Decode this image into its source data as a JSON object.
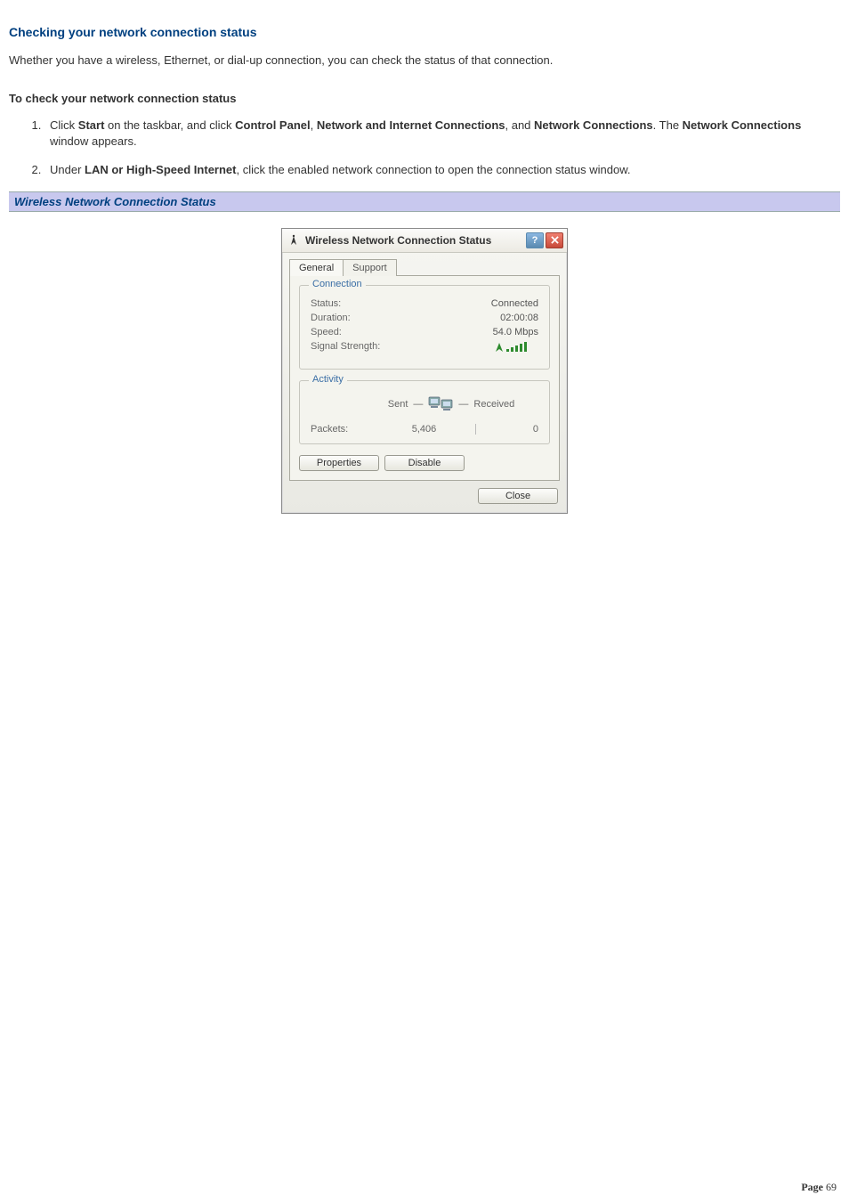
{
  "heading": "Checking your network connection status",
  "intro": "Whether you have a wireless, Ethernet, or dial-up connection, you can check the status of that connection.",
  "sub_heading": "To check your network connection status",
  "steps": [
    {
      "pre1": "Click ",
      "b1": "Start",
      "mid1": " on the taskbar, and click ",
      "b2": "Control Panel",
      "mid2": ", ",
      "b3": "Network and Internet Connections",
      "mid3": ", and ",
      "b4": "Network Connections",
      "mid4": ". The ",
      "b5": "Network Connections",
      "post": " window appears."
    },
    {
      "pre1": "Under ",
      "b1": "LAN or High-Speed Internet",
      "post": ", click the enabled network connection to open the connection status window."
    }
  ],
  "caption": "Wireless Network Connection Status",
  "dialog": {
    "title": "Wireless Network Connection Status",
    "tabs": {
      "general": "General",
      "support": "Support"
    },
    "connection": {
      "legend": "Connection",
      "status_label": "Status:",
      "status_value": "Connected",
      "duration_label": "Duration:",
      "duration_value": "02:00:08",
      "speed_label": "Speed:",
      "speed_value": "54.0 Mbps",
      "signal_label": "Signal Strength:"
    },
    "activity": {
      "legend": "Activity",
      "sent_label": "Sent",
      "received_label": "Received",
      "packets_label": "Packets:",
      "packets_sent": "5,406",
      "packets_received": "0"
    },
    "buttons": {
      "properties": "Properties",
      "disable": "Disable",
      "close": "Close"
    }
  },
  "page_number": {
    "label": "Page ",
    "value": "69"
  }
}
